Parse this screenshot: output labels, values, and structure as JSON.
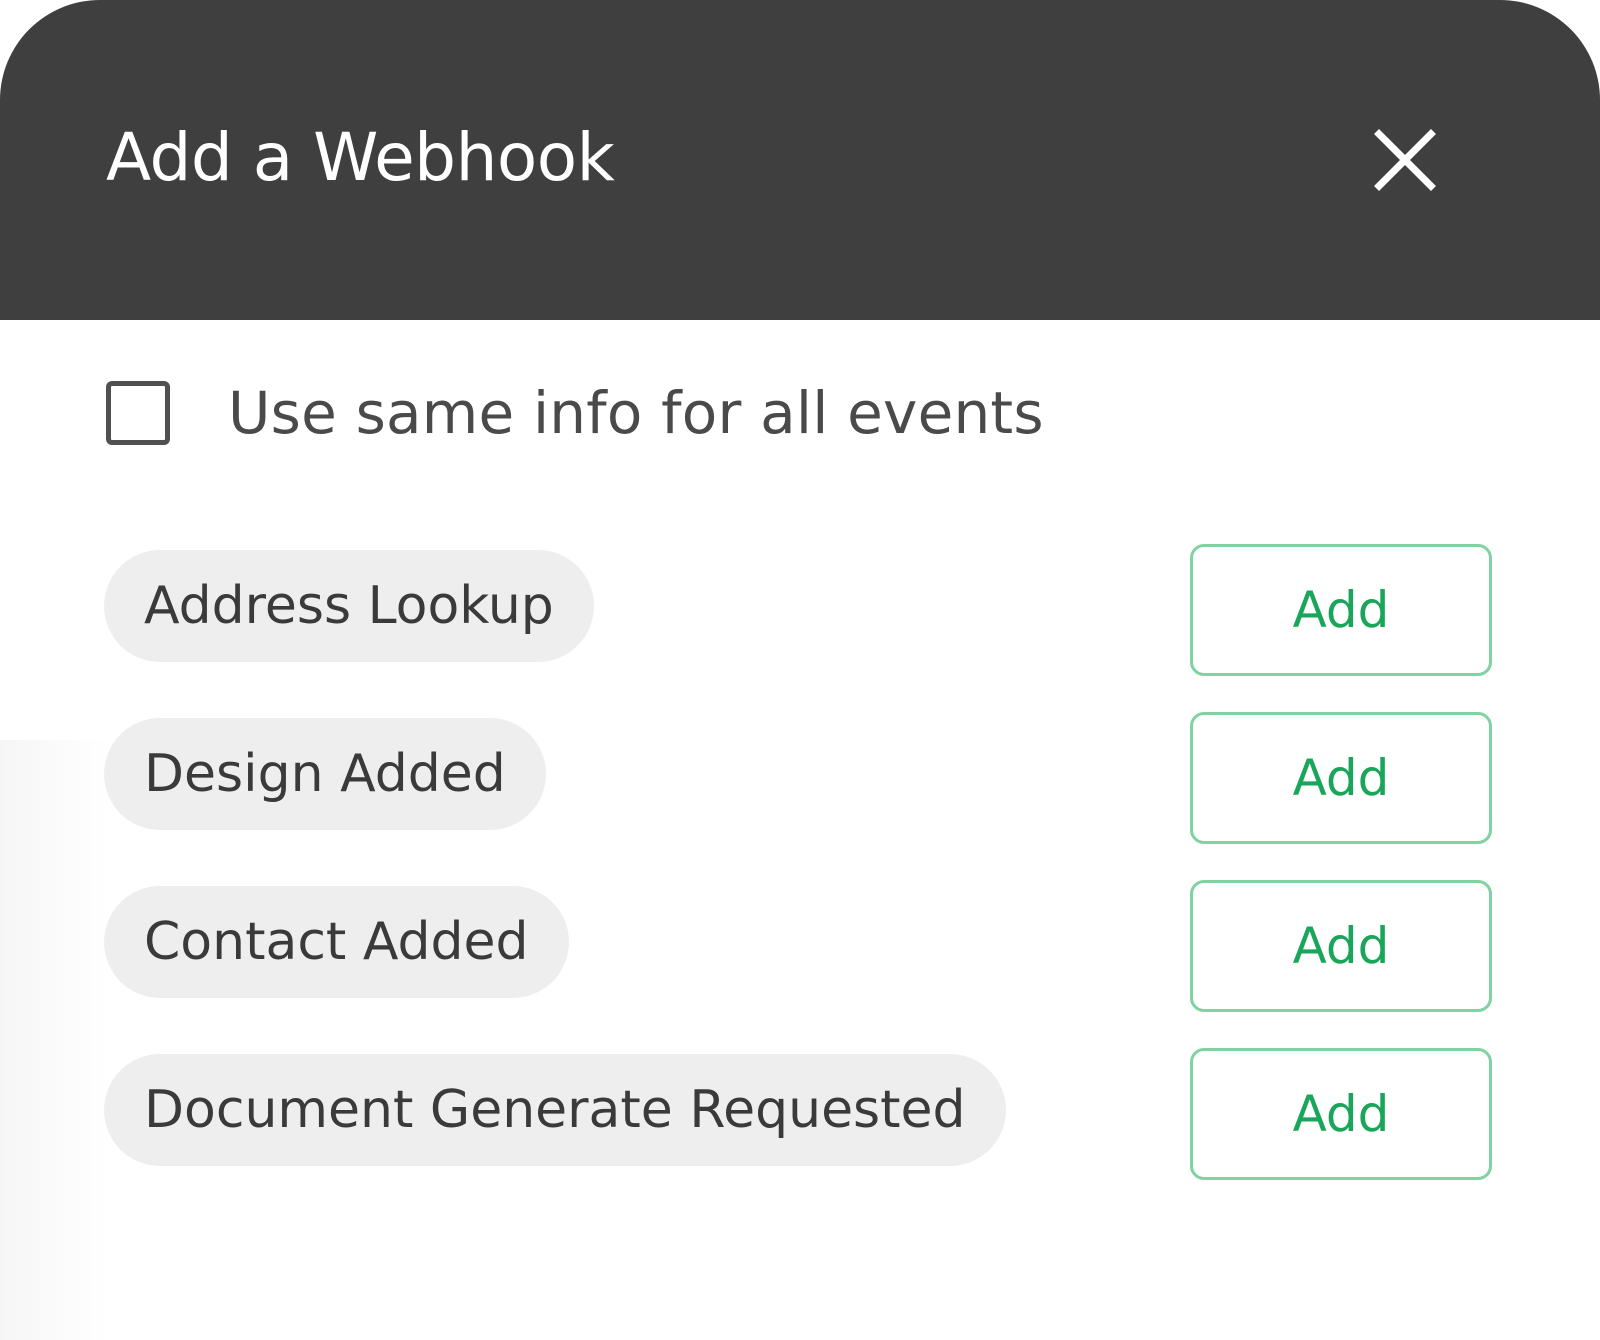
{
  "colors": {
    "header_bg": "#3f3f3f",
    "header_text": "#ffffff",
    "accent_green": "#1aa65a",
    "accent_green_border": "#7fd3a0",
    "chip_bg": "#eeeeee"
  },
  "modal": {
    "title": "Add a Webhook",
    "close_icon": "close-icon"
  },
  "options": {
    "same_info_label": "Use same info for all events",
    "same_info_checked": false
  },
  "events": [
    {
      "name": "Address Lookup",
      "action_label": "Add"
    },
    {
      "name": "Design Added",
      "action_label": "Add"
    },
    {
      "name": "Contact Added",
      "action_label": "Add"
    },
    {
      "name": "Document Generate Requested",
      "action_label": "Add"
    }
  ]
}
